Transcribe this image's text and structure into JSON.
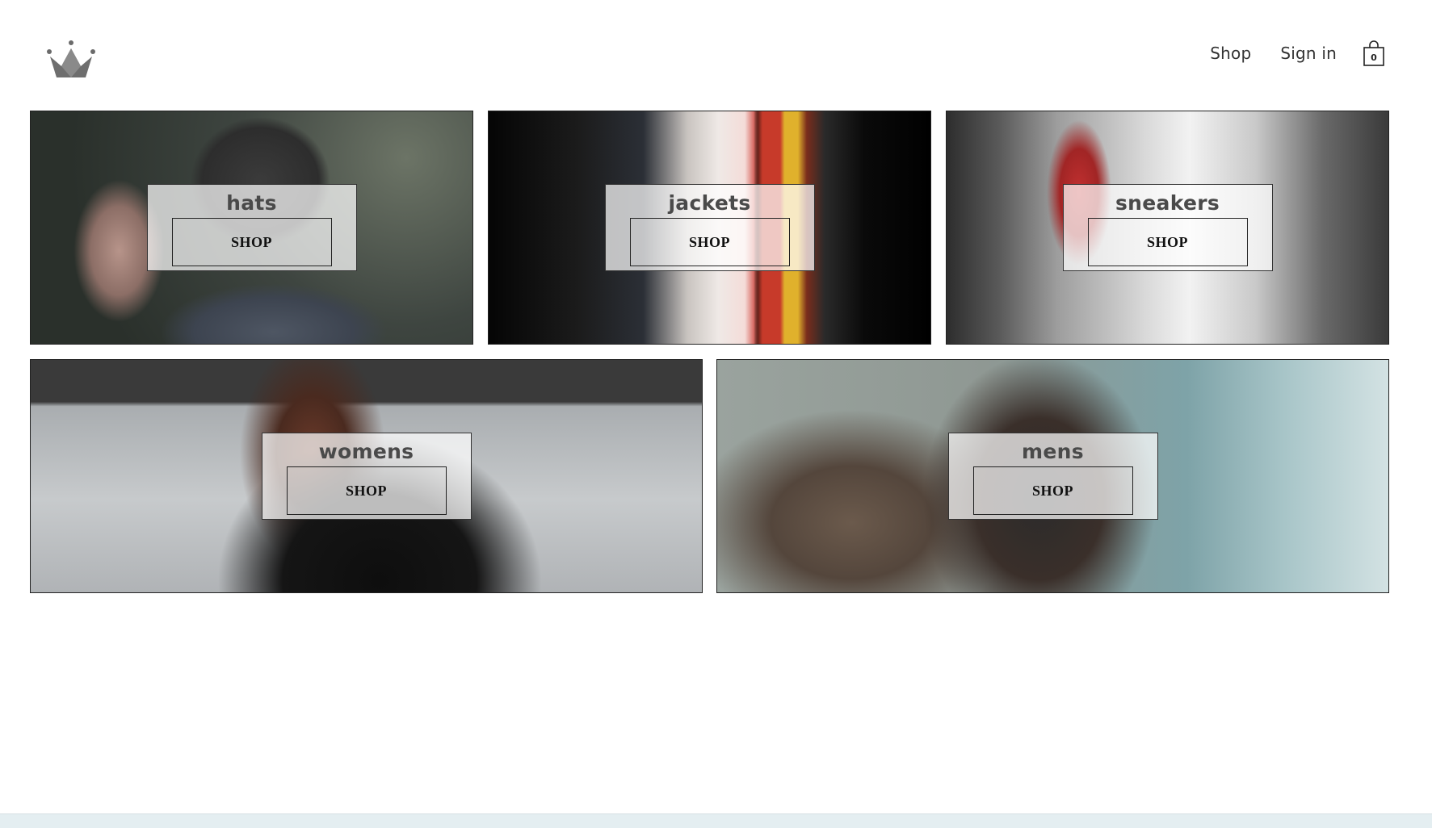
{
  "header": {
    "nav": {
      "shop_label": "Shop",
      "signin_label": "Sign in"
    },
    "cart": {
      "count": "0"
    },
    "logo_icon": "crown-icon"
  },
  "collections": [
    {
      "title": "hats",
      "button": "SHOP"
    },
    {
      "title": "jackets",
      "button": "SHOP"
    },
    {
      "title": "sneakers",
      "button": "SHOP"
    },
    {
      "title": "womens",
      "button": "SHOP"
    },
    {
      "title": "mens",
      "button": "SHOP"
    }
  ],
  "colors": {
    "background": "#ffffff",
    "text": "#333333",
    "overlay": "rgba(255,255,255,0.72)"
  }
}
